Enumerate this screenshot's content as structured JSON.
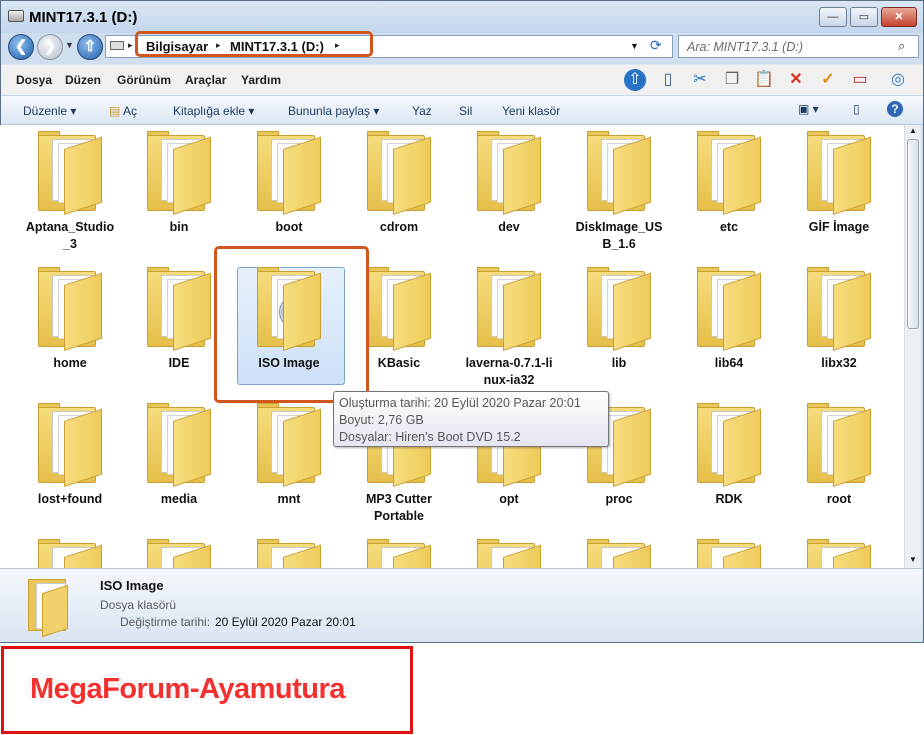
{
  "window": {
    "title": "MINT17.3.1 (D:)"
  },
  "address": {
    "crumbs": [
      "Bilgisayar",
      "MINT17.3.1 (D:)"
    ]
  },
  "search": {
    "placeholder": "Ara: MINT17.3.1 (D:)"
  },
  "menu": [
    "Dosya",
    "Düzen",
    "Görünüm",
    "Araçlar",
    "Yardım"
  ],
  "commands": {
    "organize": "Düzenle",
    "open": "Aç",
    "library": "Kitaplığa ekle",
    "share": "Bununla paylaş",
    "burn": "Yaz",
    "delete": "Sil",
    "new_folder": "Yeni klasör"
  },
  "folders": [
    {
      "name": "Aptana_Studio_3",
      "line1": "Aptana_Studio",
      "line2": "_3"
    },
    {
      "name": "bin",
      "line1": "bin",
      "line2": ""
    },
    {
      "name": "boot",
      "line1": "boot",
      "line2": ""
    },
    {
      "name": "cdrom",
      "line1": "cdrom",
      "line2": ""
    },
    {
      "name": "dev",
      "line1": "dev",
      "line2": ""
    },
    {
      "name": "DiskImage_USB_1.6",
      "line1": "DiskImage_US",
      "line2": "B_1.6"
    },
    {
      "name": "etc",
      "line1": "etc",
      "line2": ""
    },
    {
      "name": "GİF İmage",
      "line1": "GİF İmage",
      "line2": ""
    },
    {
      "name": "home",
      "line1": "home",
      "line2": ""
    },
    {
      "name": "IDE",
      "line1": "IDE",
      "line2": ""
    },
    {
      "name": "ISO Image",
      "line1": "ISO Image",
      "line2": ""
    },
    {
      "name": "KBasic",
      "line1": "KBasic",
      "line2": ""
    },
    {
      "name": "laverna-0.7.1-linux-ia32",
      "line1": "laverna-0.7.1-li",
      "line2": "nux-ia32"
    },
    {
      "name": "lib",
      "line1": "lib",
      "line2": ""
    },
    {
      "name": "lib64",
      "line1": "lib64",
      "line2": ""
    },
    {
      "name": "libx32",
      "line1": "libx32",
      "line2": ""
    },
    {
      "name": "lost+found",
      "line1": "lost+found",
      "line2": ""
    },
    {
      "name": "media",
      "line1": "media",
      "line2": ""
    },
    {
      "name": "mnt",
      "line1": "mnt",
      "line2": ""
    },
    {
      "name": "MP3 Cutter Portable",
      "line1": "MP3 Cutter",
      "line2": "Portable"
    },
    {
      "name": "opt",
      "line1": "opt",
      "line2": ""
    },
    {
      "name": "proc",
      "line1": "proc",
      "line2": ""
    },
    {
      "name": "RDK",
      "line1": "RDK",
      "line2": ""
    },
    {
      "name": "root",
      "line1": "root",
      "line2": ""
    }
  ],
  "tooltip": {
    "created": "Oluşturma tarihi: 20 Eylül 2020 Pazar 20:01",
    "size": "Boyut: 2,76 GB",
    "files": "Dosyalar: Hiren's Boot DVD 15.2"
  },
  "details": {
    "name": "ISO Image",
    "type": "Dosya klasörü",
    "modified_label": "Değiştirme tarihi:",
    "modified": "20 Eylül 2020 Pazar 20:01"
  },
  "watermark": "MegaForum-Ayamutura"
}
